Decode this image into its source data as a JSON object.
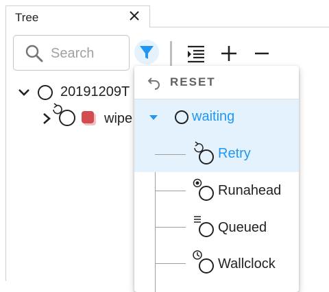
{
  "tab": {
    "title": "Tree"
  },
  "search": {
    "placeholder": "Search"
  },
  "tree": {
    "rows": [
      {
        "label": "20191209T"
      },
      {
        "label": "wipe"
      }
    ]
  },
  "filter_menu": {
    "reset_label": "RESET",
    "group_label": "waiting",
    "items": [
      {
        "label": "Retry",
        "selected": true
      },
      {
        "label": "Runahead",
        "selected": false
      },
      {
        "label": "Queued",
        "selected": false
      },
      {
        "label": "Wallclock",
        "selected": false
      }
    ]
  },
  "colors": {
    "accent": "#2196f3",
    "selected_bg": "#e3f2fd",
    "task_failed": "#d34d50"
  }
}
